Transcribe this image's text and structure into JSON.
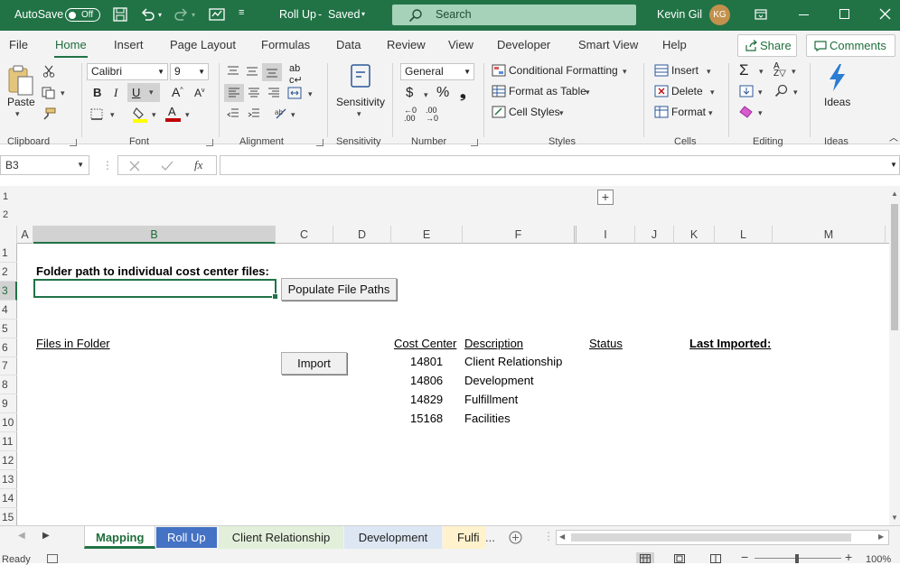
{
  "titlebar": {
    "autosave_label": "AutoSave",
    "autosave_state": "Off",
    "doc_title": "Roll Up",
    "save_status": "Saved",
    "search_placeholder": "Search",
    "user_name": "Kevin Gil",
    "user_initials": "KG"
  },
  "menu": {
    "tabs": [
      "File",
      "Home",
      "Insert",
      "Page Layout",
      "Formulas",
      "Data",
      "Review",
      "View",
      "Developer",
      "Smart View",
      "Help"
    ],
    "active_tab": "Home",
    "share_label": "Share",
    "comments_label": "Comments"
  },
  "ribbon": {
    "groups": [
      "Clipboard",
      "Font",
      "Alignment",
      "Sensitivity",
      "Number",
      "Styles",
      "Cells",
      "Editing",
      "Ideas"
    ],
    "paste_label": "Paste",
    "font_name": "Calibri",
    "font_size": "9",
    "sensitivity_label": "Sensitivity",
    "number_format": "General",
    "conditional_formatting": "Conditional Formatting",
    "format_as_table": "Format as Table",
    "cell_styles": "Cell Styles",
    "insert_label": "Insert",
    "delete_label": "Delete",
    "format_label": "Format",
    "ideas_label": "Ideas",
    "accent_color": "#217346"
  },
  "formula_bar": {
    "name_box": "B3",
    "fx_symbol": "fx",
    "formula": ""
  },
  "sheet": {
    "columns": [
      "A",
      "B",
      "C",
      "D",
      "E",
      "F",
      "I",
      "J",
      "K",
      "L",
      "M"
    ],
    "selected_column": "B",
    "rows": [
      "1",
      "2",
      "3",
      "4",
      "5",
      "6",
      "7",
      "8",
      "9",
      "10",
      "11",
      "12",
      "13",
      "14",
      "15"
    ],
    "selected_row": "3",
    "outline_levels": [
      "1",
      "2"
    ],
    "folder_label": "Folder path to individual cost center files:",
    "populate_button": "Populate File Paths",
    "files_header": "Files in Folder",
    "import_button": "Import",
    "cost_center_header": "Cost Center",
    "description_header": "Description",
    "status_header": "Status",
    "last_imported_header": "Last Imported:",
    "cost_centers": [
      {
        "code": "14801",
        "description": "Client Relationship"
      },
      {
        "code": "14806",
        "description": "Development"
      },
      {
        "code": "14829",
        "description": "Fulfillment"
      },
      {
        "code": "15168",
        "description": "Facilities"
      }
    ]
  },
  "sheet_tabs": {
    "tabs": [
      {
        "name": "Mapping",
        "color": "#ffffff",
        "active": true
      },
      {
        "name": "Roll Up",
        "color": "#4472c4",
        "active": false
      },
      {
        "name": "Client Relationship",
        "color": "#e2efda",
        "active": false
      },
      {
        "name": "Development",
        "color": "#dde6f3",
        "active": false
      },
      {
        "name": "Fulfi",
        "color": "#fff2cc",
        "active": false
      }
    ],
    "more_label": "..."
  },
  "status_bar": {
    "state": "Ready",
    "zoom": "100%"
  }
}
